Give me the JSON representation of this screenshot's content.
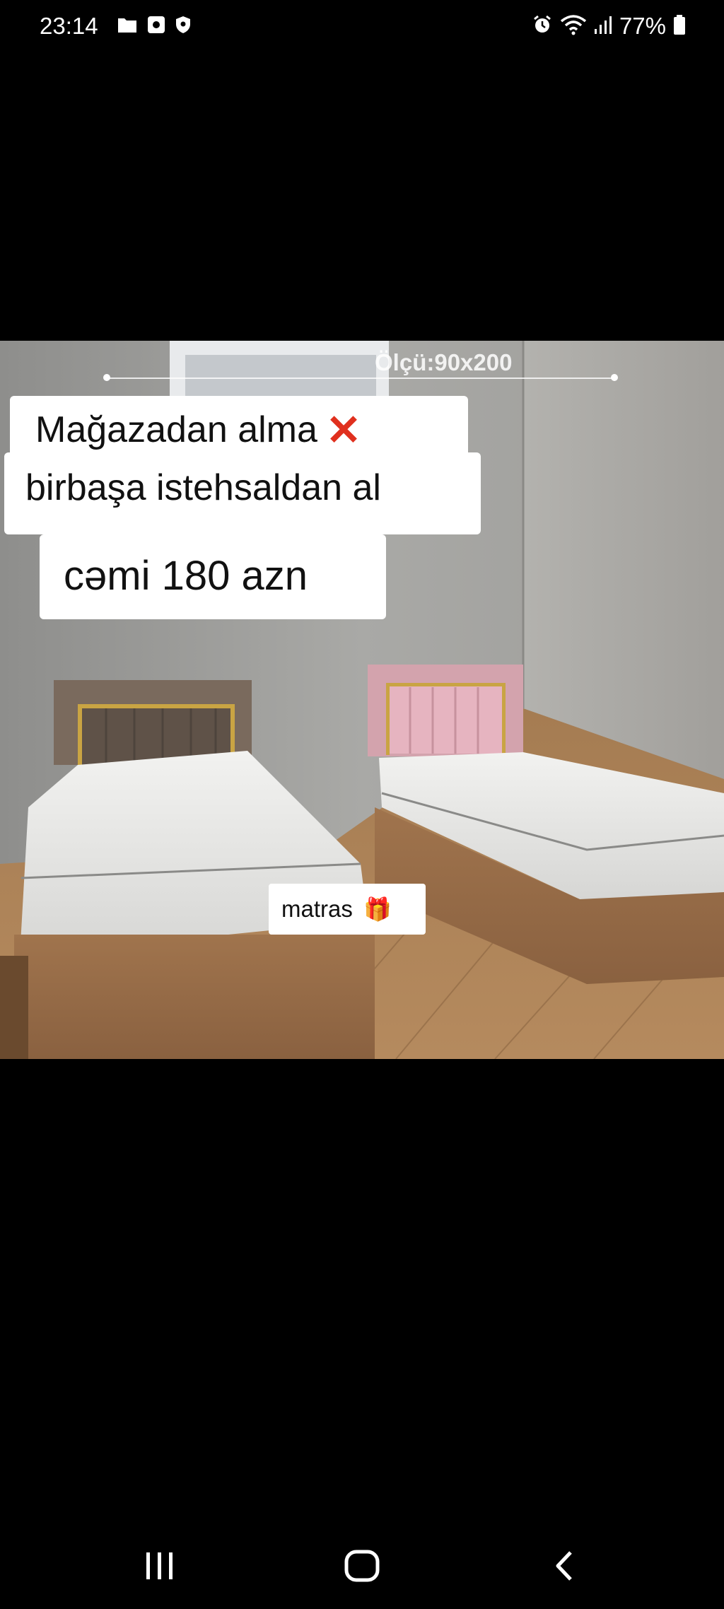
{
  "status_bar": {
    "time": "23:14",
    "battery_percent": "77%",
    "left_icons": [
      "folder-icon",
      "camera-app-icon",
      "shield-icon"
    ],
    "right_icons": [
      "alarm-icon",
      "wifi-icon",
      "signal-icon",
      "battery-icon"
    ]
  },
  "post": {
    "dimension_label": "Ölçü:90x200",
    "headline_line1": "Mağazadan alma",
    "headline_line2": "birbaşa istehsaldan al",
    "price": "cəmi 180 azn",
    "mattress_tag": "matras",
    "cross_emoji": "✕",
    "gift_emoji": "🎁"
  },
  "nav_bar": {
    "buttons": [
      "recent-apps",
      "home",
      "back"
    ]
  }
}
